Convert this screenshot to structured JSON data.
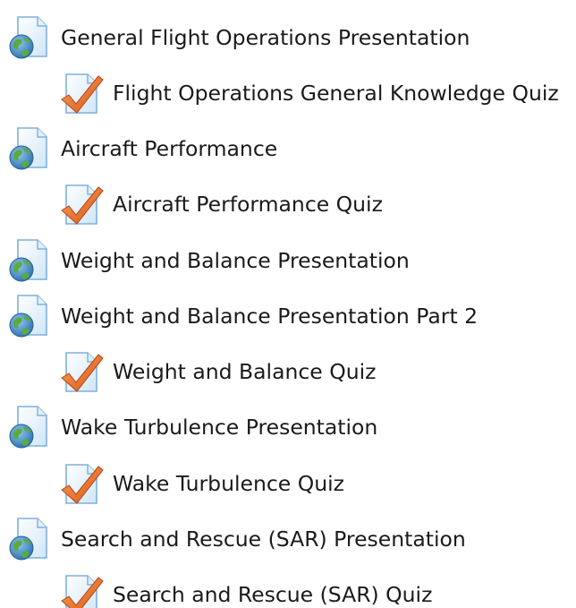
{
  "activities": [
    {
      "type": "page",
      "icon": "web-page-icon",
      "label": "General Flight Operations Presentation"
    },
    {
      "type": "quiz",
      "icon": "quiz-checkmark-icon",
      "label": "Flight Operations General Knowledge Quiz"
    },
    {
      "type": "page",
      "icon": "web-page-icon",
      "label": "Aircraft Performance"
    },
    {
      "type": "quiz",
      "icon": "quiz-checkmark-icon",
      "label": "Aircraft Performance Quiz"
    },
    {
      "type": "page",
      "icon": "web-page-icon",
      "label": "Weight and Balance Presentation"
    },
    {
      "type": "page",
      "icon": "web-page-icon",
      "label": "Weight and Balance Presentation Part 2"
    },
    {
      "type": "quiz",
      "icon": "quiz-checkmark-icon",
      "label": "Weight and Balance Quiz"
    },
    {
      "type": "page",
      "icon": "web-page-icon",
      "label": "Wake Turbulence Presentation"
    },
    {
      "type": "quiz",
      "icon": "quiz-checkmark-icon",
      "label": "Wake Turbulence Quiz"
    },
    {
      "type": "page",
      "icon": "web-page-icon",
      "label": "Search and Rescue (SAR) Presentation"
    },
    {
      "type": "quiz",
      "icon": "quiz-checkmark-icon",
      "label": "Search and Rescue (SAR) Quiz"
    }
  ]
}
